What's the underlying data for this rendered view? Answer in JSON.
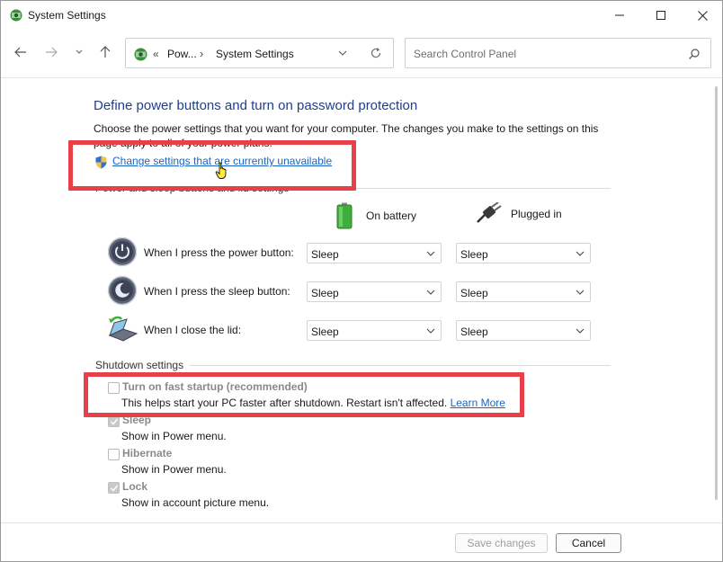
{
  "window": {
    "title": "System Settings"
  },
  "nav": {
    "breadcrumb": {
      "prefix": "«",
      "root": "Pow...",
      "separator": "›",
      "current": "System Settings"
    },
    "search_placeholder": "Search Control Panel"
  },
  "main": {
    "heading": "Define power buttons and turn on password protection",
    "description": "Choose the power settings that you want for your computer. The changes you make to the settings on this page apply to all of your power plans.",
    "change_link": "Change settings that are currently unavailable",
    "section_power": "Power and sleep buttons and lid settings",
    "columns": {
      "battery": "On battery",
      "plugged": "Plugged in"
    },
    "rows": [
      {
        "label": "When I press the power button:",
        "battery": "Sleep",
        "plugged": "Sleep",
        "icon": "power-button-icon"
      },
      {
        "label": "When I press the sleep button:",
        "battery": "Sleep",
        "plugged": "Sleep",
        "icon": "sleep-button-icon"
      },
      {
        "label": "When I close the lid:",
        "battery": "Sleep",
        "plugged": "Sleep",
        "icon": "laptop-lid-icon"
      }
    ],
    "section_shutdown": "Shutdown settings",
    "shutdown_options": [
      {
        "title": "Turn on fast startup (recommended)",
        "desc": "This helps start your PC faster after shutdown. Restart isn't affected.",
        "link": "Learn More",
        "checked": false
      },
      {
        "title": "Sleep",
        "desc": "Show in Power menu.",
        "checked": true
      },
      {
        "title": "Hibernate",
        "desc": "Show in Power menu.",
        "checked": false
      },
      {
        "title": "Lock",
        "desc": "Show in account picture menu.",
        "checked": true
      }
    ]
  },
  "footer": {
    "save": "Save changes",
    "cancel": "Cancel"
  },
  "colors": {
    "heading": "#1e3f8c",
    "link": "#1a65c4",
    "highlight": "#e8404a"
  }
}
